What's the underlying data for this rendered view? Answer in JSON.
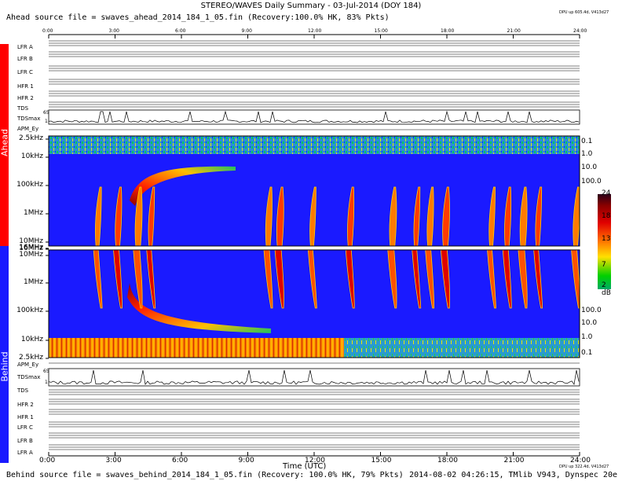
{
  "title": "STEREO/WAVES Daily Summary - 03-Jul-2014 (DOY 184)",
  "ahead_source": "Ahead source file = swaves_ahead_2014_184_1_05.fin (Recovery:100.0% HK, 83% Pkts)",
  "behind_source": "Behind source file = swaves_behind_2014_184_1_05.fin (Recovery: 100.0% HK, 79% Pkts)",
  "generated": "2014-08-02 04:26:15, TMlib V943, Dynspec 20e",
  "dpu_top": "DPU up 605.4d, V413d27",
  "dpu_bottom": "DPU up 322.4d, V413d27",
  "side": {
    "ahead": "Ahead",
    "behind": "Behind",
    "ahead_color": "#ff0000",
    "behind_color": "#1a1aff"
  },
  "time_labels": [
    "0:00",
    "3:00",
    "6:00",
    "9:00",
    "12:00",
    "15:00",
    "18:00",
    "21:00",
    "24:00"
  ],
  "time_axis_label": "Time (UTC)",
  "ahead_channels": [
    "LFR A",
    "LFR B",
    "LFR C",
    "HFR 1",
    "HFR 2",
    "TDS",
    "TDSmax",
    "APM_Ey"
  ],
  "behind_channels": [
    "APM_Ey",
    "TDSmax",
    "TDS",
    "HFR 2",
    "HFR 1",
    "LFR C",
    "LFR B",
    "LFR A"
  ],
  "freq_labels_ahead": [
    "2.5kHz",
    "10kHz",
    "100kHz",
    "1MHz",
    "10MHz",
    "16MHz"
  ],
  "freq_labels_behind": [
    "16MHz",
    "10MHz",
    "1MHz",
    "100kHz",
    "10kHz",
    "2.5kHz"
  ],
  "right_labels_ahead": [
    "0.1",
    "1.0",
    "10.0",
    "100.0"
  ],
  "right_labels_behind": [
    "100.0",
    "10.0",
    "1.0",
    "0.1"
  ],
  "colorbar": {
    "labels": [
      "24",
      "18",
      "13",
      "7",
      "2"
    ],
    "unit": "dB"
  },
  "tdsmax_ahead_labels": [
    "65",
    "1"
  ],
  "tdsmax_behind_labels": [
    "65",
    "1"
  ],
  "chart_data": {
    "type": "heatmap",
    "title": "STEREO/WAVES Daily Summary - 03-Jul-2014 (DOY 184)",
    "xlabel": "Time (UTC)",
    "xlim": [
      0,
      24
    ],
    "colorbar_range_db": [
      2,
      24
    ],
    "type_iii_bursts_utc": [
      2.1,
      3.0,
      3.9,
      4.5,
      9.8,
      10.3,
      11.8,
      13.5,
      15.4,
      16.5,
      17.1,
      17.8,
      19.9,
      20.6,
      21.3,
      22.0,
      23.7
    ],
    "slow_drift_event_utc": [
      3.8,
      9.5
    ]
  }
}
